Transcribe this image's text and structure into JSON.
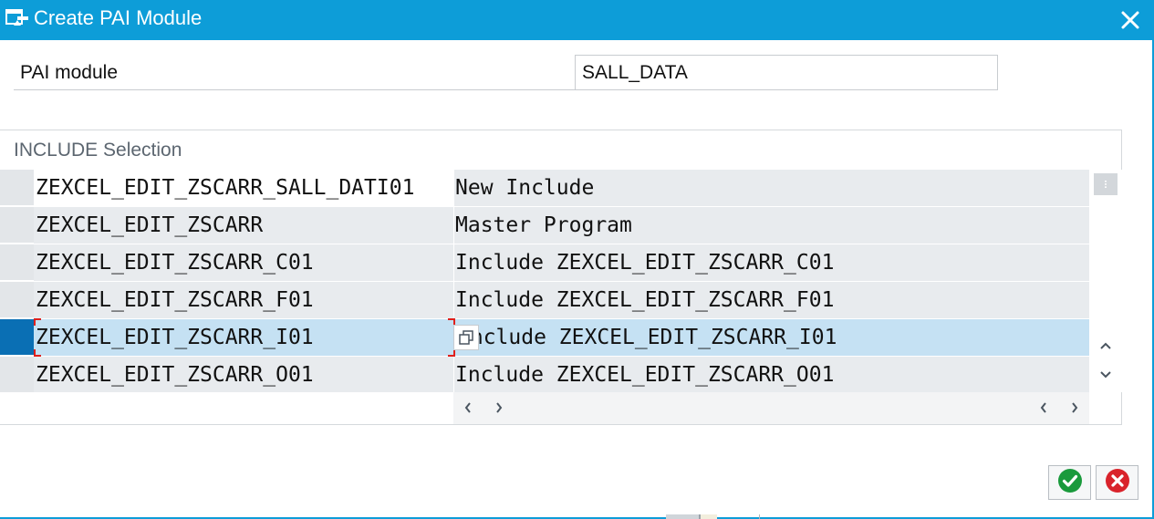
{
  "window": {
    "title": "Create PAI Module",
    "title_icon": "dialog-window-icon",
    "close_icon": "close-icon"
  },
  "colors": {
    "titlebar": "#0d9dd8",
    "selected_row": "#c5e1f3",
    "row_marker_active": "#0a6fb4",
    "ok_green": "#1a9a3c",
    "cancel_red": "#d9232b"
  },
  "pai_field": {
    "label": "PAI module",
    "value": "SALL_DATA"
  },
  "include_group": {
    "title": "INCLUDE Selection",
    "rows": [
      {
        "name": "ZEXCEL_EDIT_ZSCARR_SALL_DATI01",
        "description": "New Include"
      },
      {
        "name": "ZEXCEL_EDIT_ZSCARR",
        "description": "Master Program"
      },
      {
        "name": "ZEXCEL_EDIT_ZSCARR_C01",
        "description": "Include ZEXCEL_EDIT_ZSCARR_C01"
      },
      {
        "name": "ZEXCEL_EDIT_ZSCARR_F01",
        "description": "Include ZEXCEL_EDIT_ZSCARR_F01"
      },
      {
        "name": "ZEXCEL_EDIT_ZSCARR_I01",
        "description": "Include ZEXCEL_EDIT_ZSCARR_I01"
      },
      {
        "name": "ZEXCEL_EDIT_ZSCARR_O01",
        "description": "Include ZEXCEL_EDIT_ZSCARR_O01"
      }
    ],
    "selected_row_index": 4
  },
  "buttons": {
    "ok_icon": "checkmark-icon",
    "cancel_icon": "cancel-x-icon"
  }
}
